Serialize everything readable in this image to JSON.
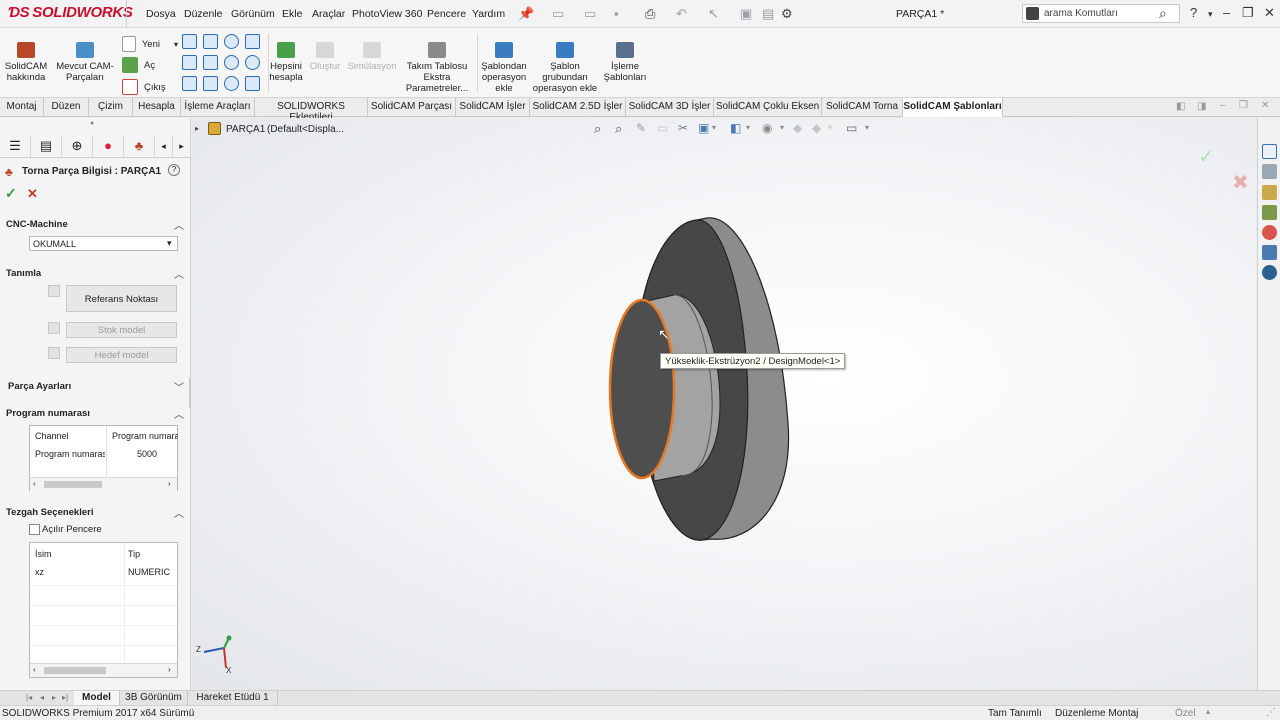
{
  "app": {
    "brand": "SOLIDWORKS",
    "doc_title": "PARÇA1 *"
  },
  "menu": [
    "Dosya",
    "Düzenle",
    "Görünüm",
    "Ekle",
    "Araçlar",
    "PhotoView 360",
    "Pencere",
    "Yardım"
  ],
  "search": {
    "placeholder": "arama Komutları"
  },
  "ribbon": {
    "solidcam_about": "SolidCAM hakkında",
    "existing_cam": "Mevcut CAM-Parçaları",
    "new": "Yeni",
    "open": "Aç",
    "exit": "Çıkış",
    "calc_all": "Hepsini hesapla",
    "create": "Oluştur",
    "simulation": "Simülasyon",
    "tool_table": "Takım Tablosu Ekstra Parametreler...",
    "from_template": "Şablondan operasyon ekle",
    "template_group": "Şablon grubundan operasyon ekle",
    "machining_templates": "İşleme Şablonları"
  },
  "tabs": [
    {
      "label": "Montaj",
      "active": false
    },
    {
      "label": "Düzen",
      "active": false
    },
    {
      "label": "Çizim",
      "active": false
    },
    {
      "label": "Hesapla",
      "active": false
    },
    {
      "label": "İşleme Araçları",
      "active": false
    },
    {
      "label": "SOLIDWORKS Eklentileri",
      "active": false
    },
    {
      "label": "SolidCAM Parçası",
      "active": false
    },
    {
      "label": "SolidCAM İşler",
      "active": false
    },
    {
      "label": "SolidCAM 2.5D İşler",
      "active": false
    },
    {
      "label": "SolidCAM 3D İşler",
      "active": false
    },
    {
      "label": "SolidCAM Çoklu Eksen",
      "active": false
    },
    {
      "label": "SolidCAM Torna",
      "active": false
    },
    {
      "label": "SolidCAM Şablonları",
      "active": true
    }
  ],
  "panel": {
    "title": "Torna Parça Bilgisi : PARÇA1",
    "cnc_section": "CNC-Machine",
    "cnc_value": "OKUMALL",
    "define_section": "Tanımla",
    "ref_point_btn": "Referans Noktası",
    "stock_model_btn": "Stok model",
    "target_model_btn": "Hedef model",
    "part_settings": "Parça Ayarları",
    "program_section": "Program numarası",
    "program_table": {
      "headers": [
        "Channel",
        "Program numarası"
      ],
      "rows": [
        [
          "Program numarası",
          "5000"
        ]
      ]
    },
    "machine_options": "Tezgah Seçenekleri",
    "open_window": "Açılır Pencere",
    "options_table": {
      "headers": [
        "İsim",
        "Tip"
      ],
      "rows": [
        [
          "xz",
          "NUMERIC"
        ]
      ]
    }
  },
  "tree": {
    "root": "PARÇA1",
    "config": "(Default<Displa..."
  },
  "tooltip": "Yükseklik-Ekstrüzyon2 / DesignModel<1>",
  "bottom_tabs": [
    {
      "label": "Model",
      "active": true
    },
    {
      "label": "3B Görünüm",
      "active": false
    },
    {
      "label": "Hareket Etüdü 1",
      "active": false
    }
  ],
  "status": {
    "version": "SOLIDWORKS Premium 2017 x64 Sürümü",
    "defined": "Tam Tanımlı",
    "mode": "Düzenleme Montaj",
    "units": "Özel"
  },
  "colors": {
    "accent": "#c8102e",
    "highlight": "#e87722",
    "check": "#2e9e3e",
    "cross": "#c0392b"
  }
}
